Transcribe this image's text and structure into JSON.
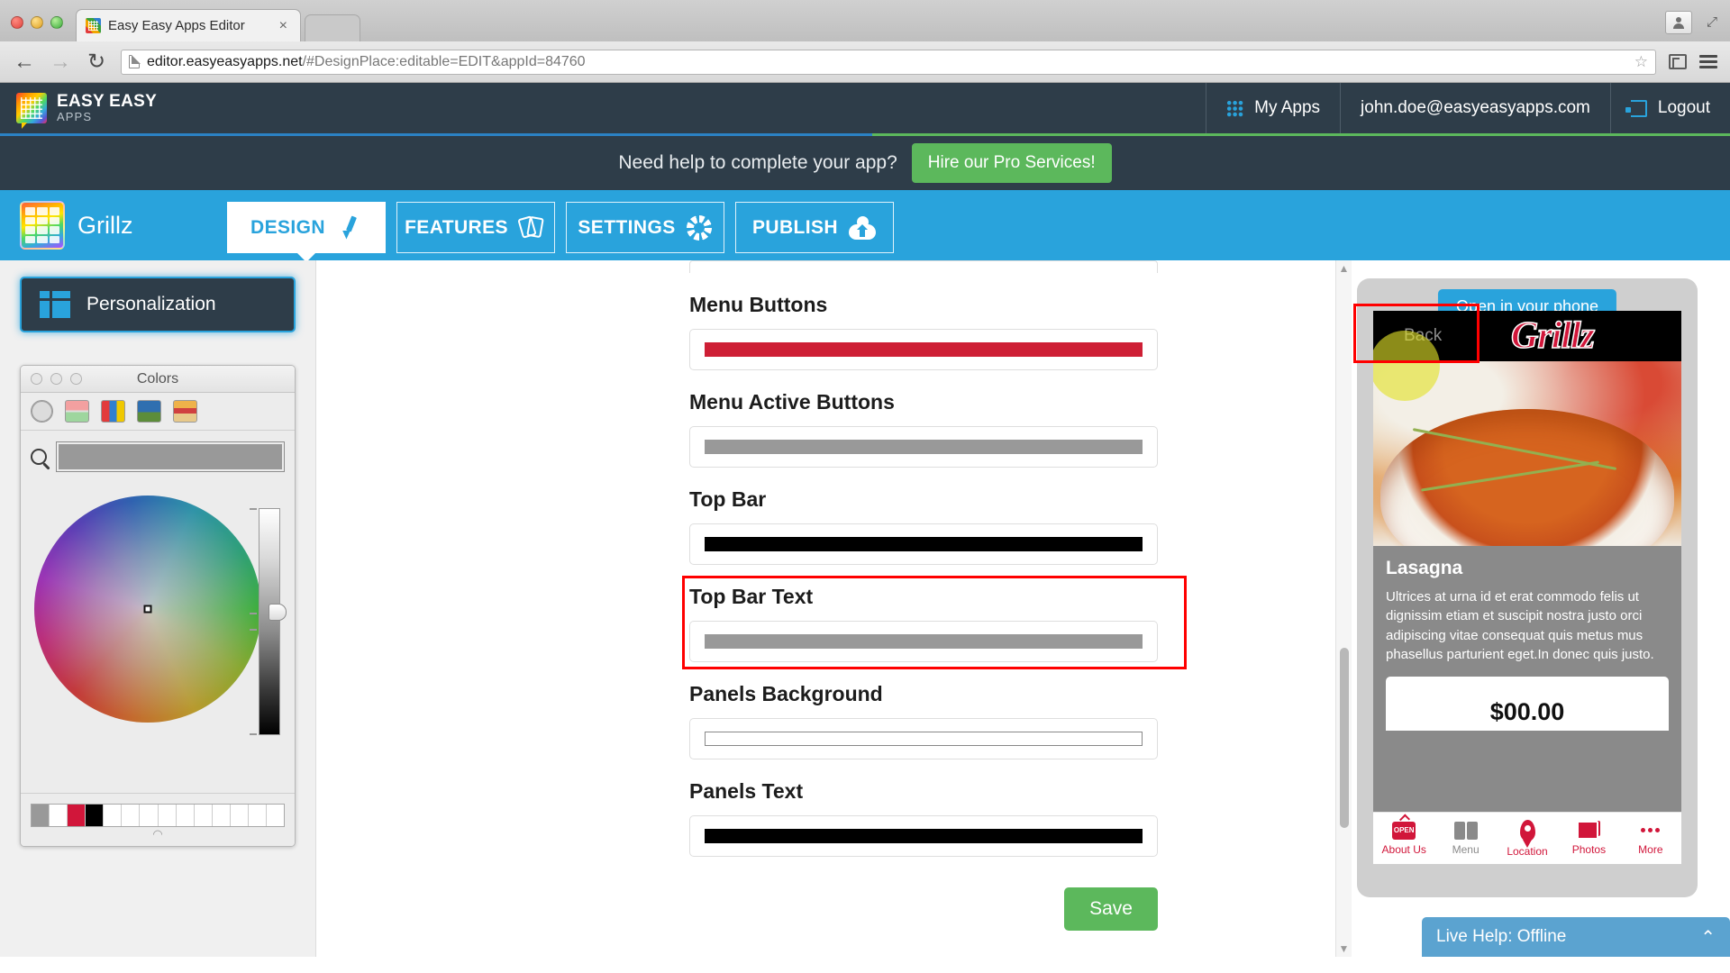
{
  "browser": {
    "tab_title": "Easy Easy Apps Editor",
    "tab_close": "×",
    "url_host": "editor.easyeasyapps.net",
    "url_rest": "/#DesignPlace:editable=EDIT&appId=84760",
    "back_arrow": "←",
    "forward_arrow": "→",
    "reload": "↻",
    "star": "☆"
  },
  "header": {
    "brand_line1": "EASY EASY",
    "brand_line2": "APPS",
    "my_apps": "My Apps",
    "user_email": "john.doe@easyeasyapps.com",
    "logout": "Logout",
    "rule_blue": "#2b82c4",
    "rule_green": "#5cb85c"
  },
  "promo": {
    "text": "Need help to complete your app?",
    "button": "Hire our Pro Services!",
    "button_color": "#5cb85c"
  },
  "appnav": {
    "app_name": "Grillz",
    "accent": "#29a3dc",
    "tabs": [
      {
        "label": "DESIGN",
        "icon": "brush-icon",
        "active": true
      },
      {
        "label": "FEATURES",
        "icon": "tags-icon",
        "active": false
      },
      {
        "label": "SETTINGS",
        "icon": "gear-icon",
        "active": false
      },
      {
        "label": "PUBLISH",
        "icon": "cloud-upload-icon",
        "active": false
      }
    ]
  },
  "sidebar": {
    "personalization_label": "Personalization",
    "color_picker": {
      "title": "Colors",
      "tools": [
        "color-wheel-tool",
        "color-sliders-tool",
        "color-palettes-tool",
        "image-palettes-tool",
        "crayons-tool"
      ],
      "selected_tool": "color-wheel-tool",
      "search_swatch_color": "#999999",
      "swatch_row": [
        "#999999",
        "#ffffff",
        "#d1163a",
        "#000000",
        "#ffffff",
        "#ffffff",
        "#ffffff",
        "#ffffff",
        "#ffffff",
        "#ffffff",
        "#ffffff",
        "#ffffff",
        "#ffffff",
        "#ffffff"
      ]
    }
  },
  "form": {
    "fields": [
      {
        "label": "Menu Buttons",
        "color": "#ce1f35",
        "outlined": false,
        "highlighted": false
      },
      {
        "label": "Menu Active Buttons",
        "color": "#999999",
        "outlined": false,
        "highlighted": false
      },
      {
        "label": "Top Bar",
        "color": "#000000",
        "outlined": false,
        "highlighted": false
      },
      {
        "label": "Top Bar Text",
        "color": "#999999",
        "outlined": false,
        "highlighted": true
      },
      {
        "label": "Panels Background",
        "color": "#ffffff",
        "outlined": true,
        "highlighted": false
      },
      {
        "label": "Panels Text",
        "color": "#000000",
        "outlined": false,
        "highlighted": false
      }
    ],
    "save_label": "Save"
  },
  "scrollbar": {
    "up_arrow": "▲",
    "down_arrow": "▼"
  },
  "preview": {
    "open_in_phone": "Open in your phone",
    "phone": {
      "back_label": "Back",
      "logo_text": "Grillz",
      "dish_title": "Lasagna",
      "dish_desc": "Ultrices at urna id et erat commodo felis ut dignissim etiam et suscipit nostra justo orci adipiscing vitae consequat quis metus mus phasellus parturient eget.In donec quis justo.",
      "price": "$00.00",
      "tabbar": [
        {
          "label": "About Us",
          "icon": "open-sign-icon",
          "color": "#d1163a"
        },
        {
          "label": "Menu",
          "icon": "book-icon",
          "color": "#8a8a8a"
        },
        {
          "label": "Location",
          "icon": "map-pin-icon",
          "color": "#d1163a"
        },
        {
          "label": "Photos",
          "icon": "photos-icon",
          "color": "#d1163a"
        },
        {
          "label": "More",
          "icon": "ellipsis-icon",
          "color": "#d1163a"
        }
      ]
    },
    "live_help": {
      "label": "Live Help: Offline",
      "chevron": "⌃"
    }
  }
}
